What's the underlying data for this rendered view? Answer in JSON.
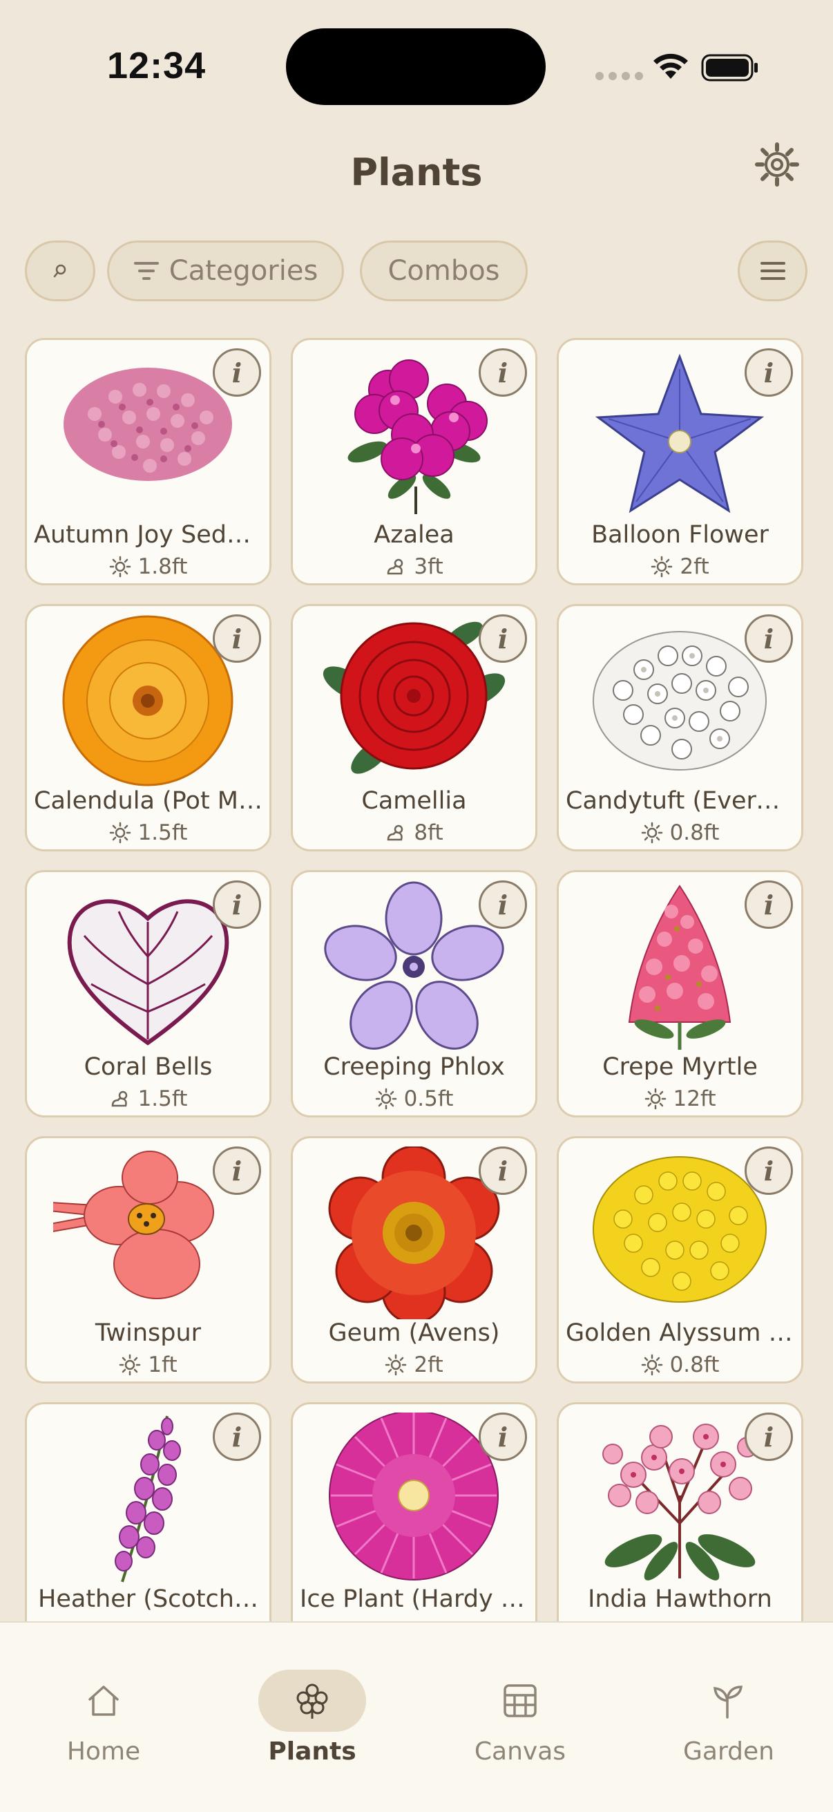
{
  "status_bar": {
    "time": "12:34"
  },
  "header": {
    "title": "Plants"
  },
  "toolbar": {
    "search_icon": "search-icon",
    "categories_label": "Categories",
    "combos_label": "Combos",
    "menu_icon": "menu-icon"
  },
  "plants": [
    {
      "name": "Autumn Joy Sedum",
      "light": "sun-icon",
      "height": "1.8ft"
    },
    {
      "name": "Azalea",
      "light": "partial-shade-icon",
      "height": "3ft"
    },
    {
      "name": "Balloon Flower",
      "light": "sun-icon",
      "height": "2ft"
    },
    {
      "name": "Calendula (Pot M…",
      "light": "sun-icon",
      "height": "1.5ft"
    },
    {
      "name": "Camellia",
      "light": "partial-shade-icon",
      "height": "8ft"
    },
    {
      "name": "Candytuft (Evergr…",
      "light": "sun-icon",
      "height": "0.8ft"
    },
    {
      "name": "Coral Bells",
      "light": "partial-shade-icon",
      "height": "1.5ft"
    },
    {
      "name": "Creeping Phlox",
      "light": "sun-icon",
      "height": "0.5ft"
    },
    {
      "name": "Crepe Myrtle",
      "light": "sun-icon",
      "height": "12ft"
    },
    {
      "name": "Twinspur",
      "light": "sun-icon",
      "height": "1ft"
    },
    {
      "name": "Geum (Avens)",
      "light": "sun-icon",
      "height": "2ft"
    },
    {
      "name": "Golden Alyssum (…",
      "light": "sun-icon",
      "height": "0.8ft"
    },
    {
      "name": "Heather (Scotch…",
      "light": "",
      "height": ""
    },
    {
      "name": "Ice Plant (Hardy I…",
      "light": "",
      "height": ""
    },
    {
      "name": "India Hawthorn",
      "light": "",
      "height": ""
    }
  ],
  "info_label": "i",
  "tabs": [
    {
      "label": "Home",
      "icon": "home-icon"
    },
    {
      "label": "Plants",
      "icon": "clover-icon",
      "active": true
    },
    {
      "label": "Canvas",
      "icon": "canvas-icon"
    },
    {
      "label": "Garden",
      "icon": "sprout-icon"
    }
  ],
  "colors": {
    "background": "#efe8da",
    "card": "#fdfbf5",
    "card_border": "#dccdb0",
    "text": "#4f4436",
    "active_tab_bg": "#e6dcc8"
  }
}
